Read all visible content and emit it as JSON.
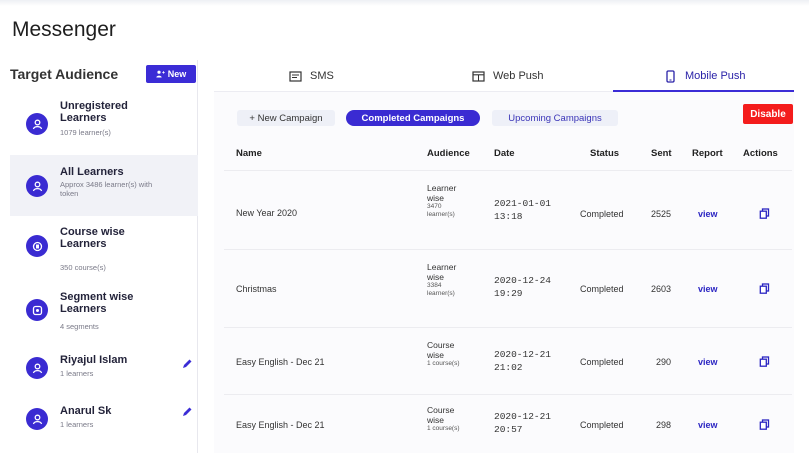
{
  "app": {
    "title": "Messenger"
  },
  "sidebar": {
    "header": "Target Audience",
    "new_button": "New",
    "items": [
      {
        "name": "Unregistered Learners",
        "sub": "1079 learner(s)",
        "icon": "users-icon",
        "editable": false,
        "active": false
      },
      {
        "name": "All Learners",
        "sub": "Approx 3486 learner(s) with token",
        "icon": "users-icon",
        "editable": false,
        "active": true
      },
      {
        "name": "Course wise Learners",
        "sub": "350 course(s)",
        "icon": "book-icon",
        "editable": false,
        "active": false
      },
      {
        "name": "Segment wise Learners",
        "sub": "4 segments",
        "icon": "segment-icon",
        "editable": false,
        "active": false
      },
      {
        "name": "Riyajul Islam",
        "sub": "1 learners",
        "icon": "users-icon",
        "editable": true,
        "active": false
      },
      {
        "name": "Anarul Sk",
        "sub": "1 learners",
        "icon": "users-icon",
        "editable": true,
        "active": false
      }
    ]
  },
  "tabs": [
    {
      "label": "SMS",
      "icon": "sms-icon"
    },
    {
      "label": "Web Push",
      "icon": "browser-icon"
    },
    {
      "label": "Mobile Push",
      "icon": "mobile-icon",
      "active": true
    }
  ],
  "actions": {
    "new_campaign": "+ New Campaign",
    "completed": "Completed Campaigns",
    "upcoming": "Upcoming Campaigns",
    "disable": "Disable"
  },
  "table": {
    "headers": [
      "Name",
      "Audience",
      "Date",
      "Status",
      "Sent",
      "Report",
      "Actions"
    ],
    "rows": [
      {
        "name": "New Year 2020",
        "audience": "Learner wise",
        "audience_count": "3470 learner(s)",
        "date": "2021-01-01",
        "time": "13:18",
        "status": "Completed",
        "sent": "2525",
        "report": "view"
      },
      {
        "name": "Christmas",
        "audience": "Learner wise",
        "audience_count": "3384 learner(s)",
        "date": "2020-12-24",
        "time": "19:29",
        "status": "Completed",
        "sent": "2603",
        "report": "view"
      },
      {
        "name": "Easy English - Dec 21",
        "audience": "Course wise",
        "audience_count": "1 course(s)",
        "date": "2020-12-21",
        "time": "21:02",
        "status": "Completed",
        "sent": "290",
        "report": "view"
      },
      {
        "name": "Easy English - Dec 21",
        "audience": "Course wise",
        "audience_count": "1 course(s)",
        "date": "2020-12-21",
        "time": "20:57",
        "status": "Completed",
        "sent": "298",
        "report": "view"
      }
    ]
  },
  "colors": {
    "accent": "#3b2cd6",
    "danger": "#f41c1c",
    "link": "#2b25c2"
  }
}
